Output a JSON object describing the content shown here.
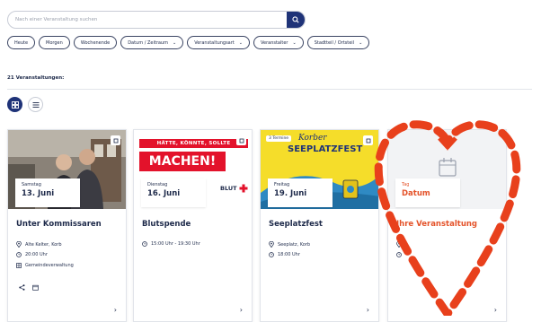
{
  "search": {
    "placeholder": "Nach einer Veranstaltung suchen"
  },
  "filters": [
    {
      "label": "Heute",
      "dropdown": false
    },
    {
      "label": "Morgen",
      "dropdown": false
    },
    {
      "label": "Wochenende",
      "dropdown": false
    },
    {
      "label": "Datum / Zeitraum",
      "dropdown": true
    },
    {
      "label": "Veranstaltungsart",
      "dropdown": true
    },
    {
      "label": "Veranstalter",
      "dropdown": true
    },
    {
      "label": "Stadtteil / Ortsteil",
      "dropdown": true
    }
  ],
  "results": {
    "count_label": "21 Veranstaltungen:"
  },
  "colors": {
    "primary": "#1f3378",
    "accent": "#e4532a",
    "text": "#1e2a4a"
  },
  "events": [
    {
      "day": "Samstag",
      "date": "13. Juni",
      "title": "Unter Kommissaren",
      "location": "Alte Kelter, Korb",
      "time": "20:00 Uhr",
      "organizer": "Gemeindeverwaltung"
    },
    {
      "day": "Dienstag",
      "date": "16. Juni",
      "title": "Blutspende",
      "time": "15:00 Uhr - 19:30 Uhr",
      "image": {
        "headline_top": "HÄTTE, KÖNNTE, SOLLTE",
        "headline_main": "MACHEN!",
        "logo": "BLUT"
      }
    },
    {
      "day": "Freitag",
      "date": "19. Juni",
      "title": "Seeplatzfest",
      "location": "Seeplatz, Korb",
      "time": "18:00 Uhr",
      "badge": "3 Termine",
      "image": {
        "line1": "Korber",
        "line2": "SEEPLATZFEST"
      }
    },
    {
      "day": "Tag",
      "date": "Datum",
      "title": "Ihre Veranstaltung"
    }
  ]
}
